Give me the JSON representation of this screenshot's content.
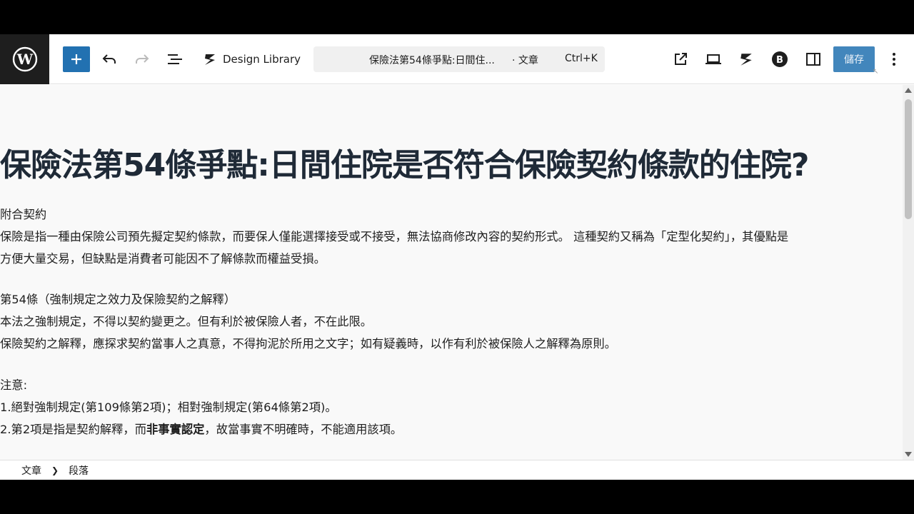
{
  "toolbar": {
    "design_library_label": "Design Library",
    "command": {
      "title": "保險法第54條爭點:日間住...",
      "type": "· 文章",
      "shortcut": "Ctrl+K"
    },
    "save_label": "儲存"
  },
  "post": {
    "title": "保險法第54條爭點:日間住院是否符合保險契約條款的住院?",
    "paragraphs": {
      "p1_l1": "附合契約",
      "p1_l2": "保險是指一種由保險公司預先擬定契約條款，而要保人僅能選擇接受或不接受，無法協商修改內容的契約形式。 這種契約又稱為「定型化契約」，其優點是",
      "p1_l3": "方便大量交易，但缺點是消費者可能因不了解條款而權益受損。",
      "p2_l1": "第54條（強制規定之效力及保險契約之解釋）",
      "p2_l2": "本法之強制規定，不得以契約變更之。但有利於被保險人者，不在此限。",
      "p2_l3": "保險契約之解釋，應探求契約當事人之真意，不得拘泥於所用之文字；如有疑義時，以作有利於被保險人之解釋為原則。",
      "p3_l1": "注意:",
      "p3_l2": "1.絕對強制規定(第109條第2項)；相對強制規定(第64條第2項)。",
      "p3_l3_a": "2.第2項是指是契約解釋，而",
      "p3_l3_b": "非事實認定",
      "p3_l3_c": "，故當事實不明確時，不能適用該項。"
    }
  },
  "breadcrumb": {
    "items": [
      "文章",
      "段落"
    ]
  },
  "colors": {
    "accent": "#2271b1",
    "logo_bg": "#1e1e1e",
    "title": "#1f2a37"
  }
}
